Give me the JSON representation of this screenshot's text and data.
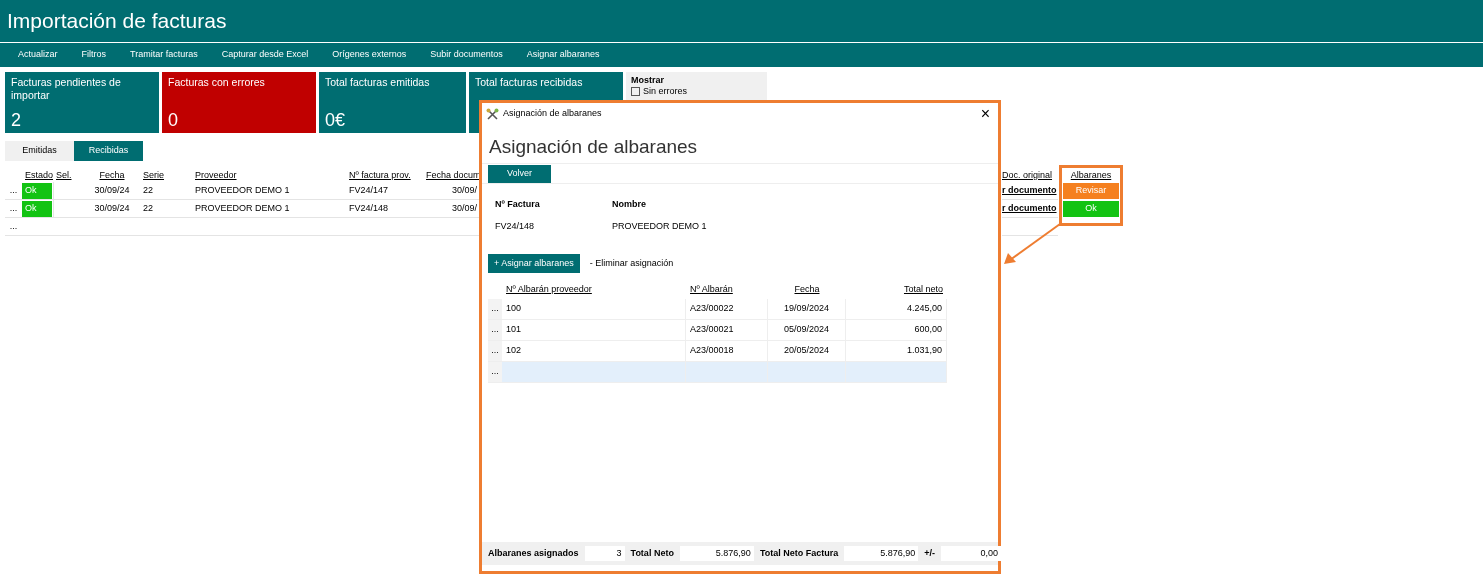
{
  "title": "Importación de facturas",
  "toolbar": [
    "Actualizar",
    "Filtros",
    "Tramitar facturas",
    "Capturar desde Excel",
    "Orígenes externos",
    "Subir documentos",
    "Asignar albaranes"
  ],
  "tiles": [
    {
      "label": "Facturas pendientes de importar",
      "value": "2",
      "color": "#006d71"
    },
    {
      "label": "Facturas con errores",
      "value": "0",
      "color": "#c00000"
    },
    {
      "label": "Total facturas emitidas",
      "value": "0€",
      "color": "#006d71"
    },
    {
      "label": "Total facturas recibidas",
      "color": "#006d71"
    }
  ],
  "filter": {
    "title": "Mostrar",
    "options": [
      {
        "label": "Sin errores",
        "checked": false
      }
    ]
  },
  "tabs": [
    {
      "label": "Emitidas",
      "selected": false
    },
    {
      "label": "Recibidas",
      "selected": true
    }
  ],
  "table": {
    "columns": [
      "Estado",
      "Sel.",
      "Fecha",
      "Serie",
      "Proveedor",
      "Nº factura prov.",
      "Fecha docum"
    ],
    "right_columns": [
      "Doc. original",
      "Albaranes"
    ],
    "rows": [
      {
        "marker": "...",
        "estado": {
          "text": "Ok",
          "color": "#13c313"
        },
        "fecha": "30/09/24",
        "serie": "22",
        "proveedor": "PROVEEDOR DEMO 1",
        "factura": "FV24/147",
        "fecha_doc": "30/09/",
        "doc": "r documento",
        "albaranes": {
          "text": "Revisar",
          "color": "#f5801f"
        }
      },
      {
        "marker": "...",
        "estado": {
          "text": "Ok",
          "color": "#13c313"
        },
        "fecha": "30/09/24",
        "serie": "22",
        "proveedor": "PROVEEDOR DEMO 1",
        "factura": "FV24/148",
        "fecha_doc": "30/09/",
        "doc": "r documento",
        "albaranes": {
          "text": "Ok",
          "color": "#13c313"
        }
      },
      {
        "marker": "..."
      }
    ]
  },
  "dialog": {
    "window_title": "Asignación de albaranes",
    "close": "×",
    "heading": "Asignación de albaranes",
    "back_button": "Volver",
    "info": [
      {
        "label": "Nº Factura",
        "value": "FV24/148"
      },
      {
        "label": "Nombre",
        "value": "PROVEEDOR DEMO 1"
      }
    ],
    "actions": [
      {
        "label": "+ Asignar albaranes",
        "kind": "primary"
      },
      {
        "label": "- Eliminar asignación",
        "kind": "plain"
      }
    ],
    "columns": [
      "Nº Albarán proveedor",
      "Nº Albarán",
      "Fecha",
      "Total neto"
    ],
    "rows": [
      {
        "marker": "...",
        "cells": [
          "100",
          "A23/00022",
          "19/09/2024",
          "4.245,00"
        ],
        "selected": false
      },
      {
        "marker": "...",
        "cells": [
          "101",
          "A23/00021",
          "05/09/2024",
          "600,00"
        ],
        "selected": false
      },
      {
        "marker": "...",
        "cells": [
          "102",
          "A23/00018",
          "20/05/2024",
          "1.031,90"
        ],
        "selected": false
      },
      {
        "marker": "...",
        "cells": [],
        "selected": true
      }
    ],
    "footer": [
      {
        "label": "Albaranes asignados",
        "value": "3"
      },
      {
        "label": "Total Neto",
        "value": "5.876,90"
      },
      {
        "label": "Total Neto Factura",
        "value": "5.876,90"
      },
      {
        "label": "+/-",
        "value": "0,00"
      }
    ]
  }
}
